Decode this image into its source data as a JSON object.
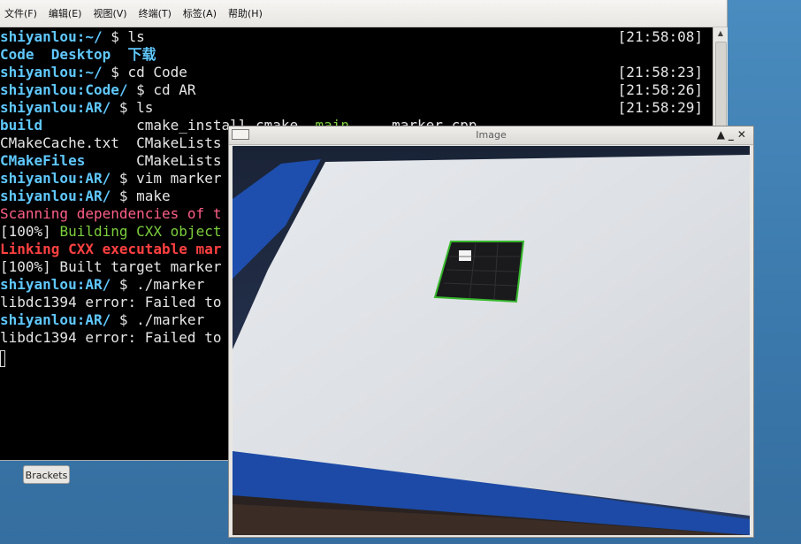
{
  "menubar": {
    "items": [
      "文件(F)",
      "编辑(E)",
      "视图(V)",
      "终端(T)",
      "标签(A)",
      "帮助(H)"
    ]
  },
  "terminal": {
    "lines": [
      {
        "prompt": "shiyanlou:~/",
        "cmd": " $ ls",
        "time": "[21:58:08]"
      },
      {
        "plain_html": "Code  Desktop  下载"
      },
      {
        "prompt": "shiyanlou:~/",
        "cmd": " $ cd Code",
        "time": "[21:58:23]"
      },
      {
        "prompt": "shiyanlou:Code/",
        "cmd": " $ cd AR",
        "time": "[21:58:26]"
      },
      {
        "prompt": "shiyanlou:AR/",
        "cmd": " $ ls",
        "time": "[21:58:29]"
      },
      {
        "text": "build            cmake_install.cmake  main.cpp  marker.cpp"
      },
      {
        "text": "CMakeCache.txt   CMakeLists"
      },
      {
        "text": "CMakeFiles       CMakeLists"
      },
      {
        "prompt": "shiyanlou:AR/",
        "cmd": " $ vim marker"
      },
      {
        "prompt": "shiyanlou:AR/",
        "cmd": " $ make"
      },
      {
        "text": "Scanning dependencies of t"
      },
      {
        "text": "[100%] Building CXX object"
      },
      {
        "text": "Linking CXX executable mar"
      },
      {
        "text": "[100%] Built target marker"
      },
      {
        "prompt": "shiyanlou:AR/",
        "cmd": " $ ./marker"
      },
      {
        "text": "libdc1394 error: Failed to"
      },
      {
        "prompt": "shiyanlou:AR/",
        "cmd": " $ ./marker"
      },
      {
        "text": "libdc1394 error: Failed to"
      }
    ],
    "ls_out": {
      "a": "Code",
      "b": "Desktop",
      "c": "下载"
    },
    "row5": {
      "a": "build",
      "b": "cmake_install.cmake",
      "c": "main",
      "d": "marker.cpp"
    },
    "row6": {
      "a": "CMakeCache.txt",
      "b": "CMakeLists"
    },
    "row7": {
      "a": "CMakeFiles",
      "b": "CMakeLists"
    },
    "row10": "Scanning dependencies of t",
    "row11": {
      "a": "[100%] ",
      "b": "Building CXX object"
    },
    "row12": "Linking CXX executable mar",
    "row13": "[100%] Built target marker",
    "row15": "libdc1394 error: Failed to",
    "row17": "libdc1394 error: Failed to"
  },
  "image_window": {
    "title": "Image",
    "buttons": "▲_✕"
  },
  "taskbar": {
    "brackets_label": "Brackets"
  },
  "colors": {
    "prompt": "#5fc8ff",
    "green": "#7bcf3c",
    "red": "#ff4040",
    "marker_outline": "#36b82c"
  }
}
